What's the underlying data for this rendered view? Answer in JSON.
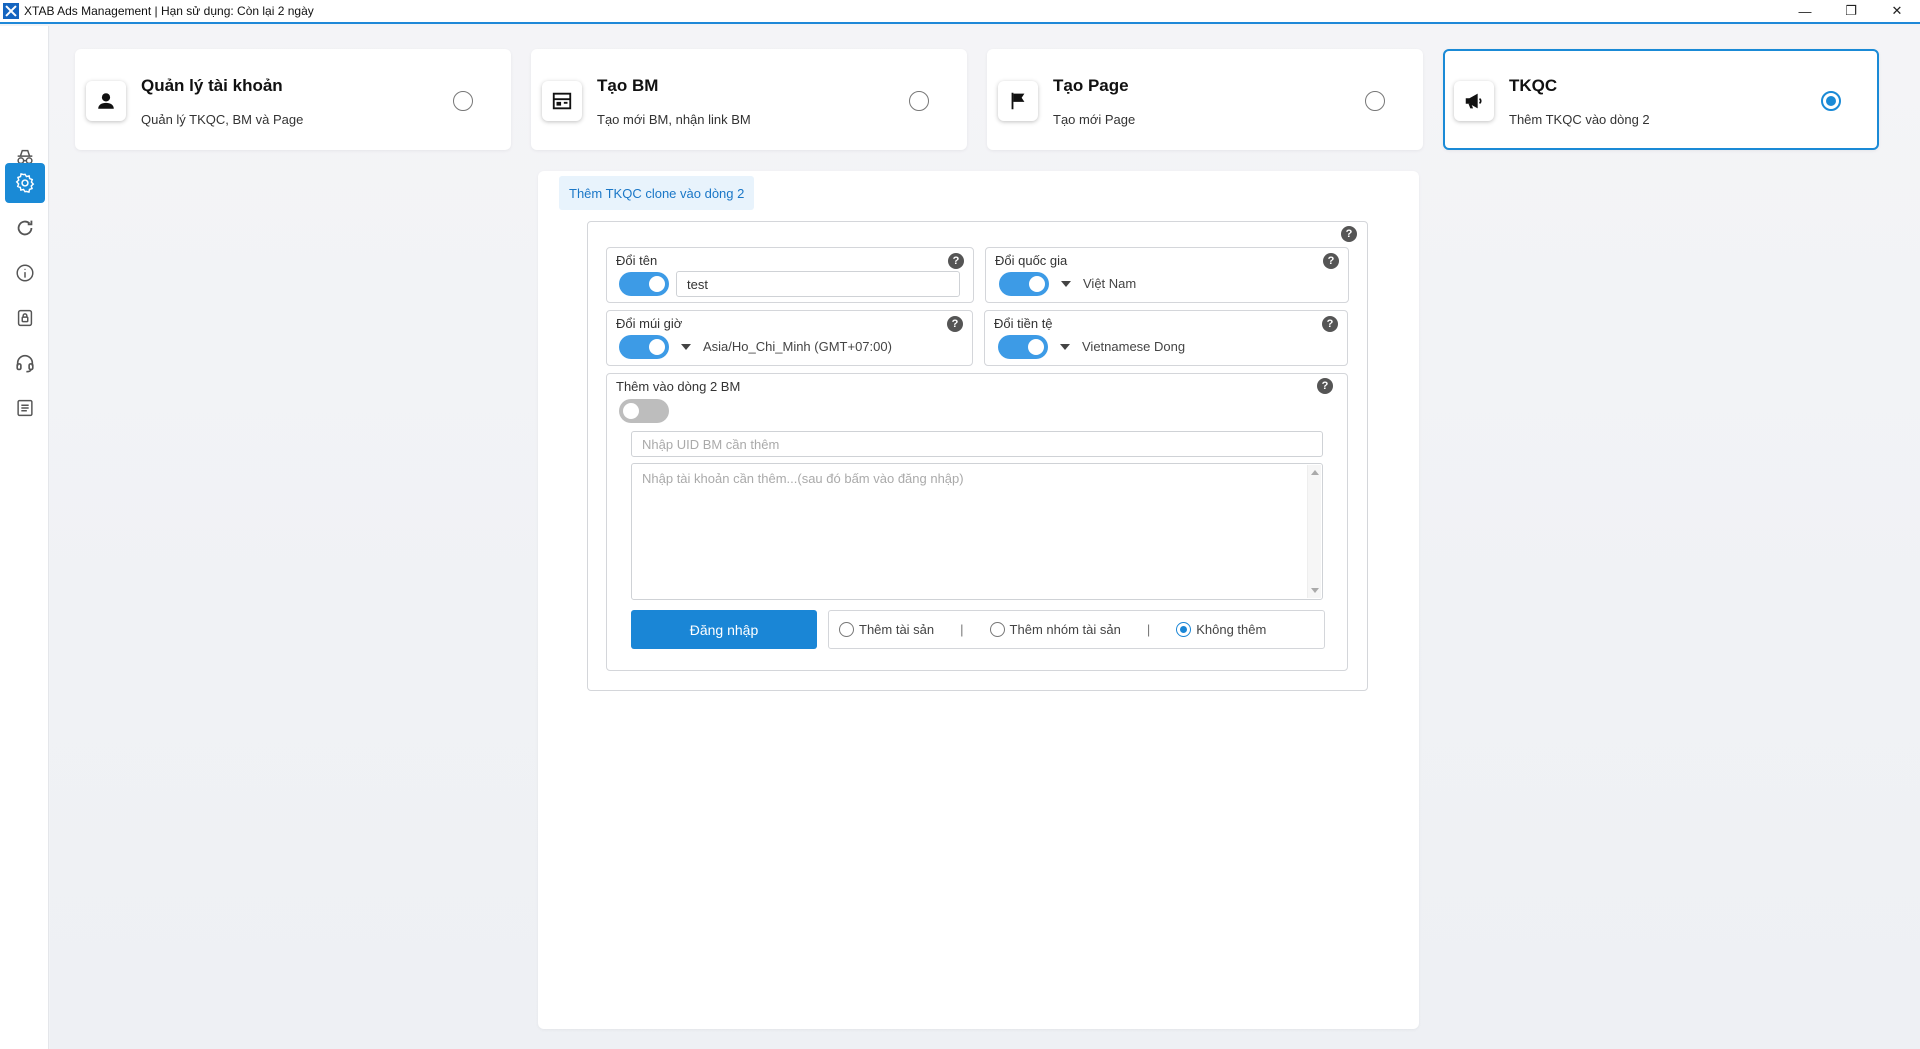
{
  "window": {
    "title": "XTAB Ads Management | Hạn sử dụng: Còn lại 2 ngày",
    "minimize": "—",
    "restore": "❐",
    "close": "✕"
  },
  "sidebar": {
    "items": [
      {
        "icon": "incognito-icon",
        "active": false
      },
      {
        "icon": "gear-icon",
        "active": true
      },
      {
        "icon": "refresh-icon",
        "active": false
      },
      {
        "icon": "info-icon",
        "active": false
      },
      {
        "icon": "lock-icon",
        "active": false
      },
      {
        "icon": "headset-icon",
        "active": false
      },
      {
        "icon": "list-icon",
        "active": false
      }
    ]
  },
  "cards": [
    {
      "title": "Quản lý tài khoản",
      "subtitle": "Quản lý TKQC, BM và Page",
      "icon": "user-icon",
      "selected": false
    },
    {
      "title": "Tạo BM",
      "subtitle": "Tạo mới BM, nhận link BM",
      "icon": "business-icon",
      "selected": false
    },
    {
      "title": "Tạo Page",
      "subtitle": "Tạo mới Page",
      "icon": "flag-icon",
      "selected": false
    },
    {
      "title": "TKQC",
      "subtitle": "Thêm TKQC vào dòng 2",
      "icon": "megaphone-icon",
      "selected": true
    }
  ],
  "panel": {
    "tab_label": "Thêm TKQC clone vào dòng 2",
    "help": "?",
    "rename": {
      "label": "Đổi tên",
      "enabled": true,
      "value": "test"
    },
    "country": {
      "label": "Đổi quốc gia",
      "enabled": true,
      "value": "Việt Nam"
    },
    "timezone": {
      "label": "Đổi múi giờ",
      "enabled": true,
      "value": "Asia/Ho_Chi_Minh (GMT+07:00)"
    },
    "currency": {
      "label": "Đổi tiền tệ",
      "enabled": true,
      "value": "Vietnamese Dong"
    },
    "add_bm": {
      "label": "Thêm vào dòng 2 BM",
      "enabled": false,
      "uid_placeholder": "Nhập UID BM cần thêm",
      "accounts_placeholder": "Nhập tài khoản cần thêm...(sau đó bấm vào đăng nhập)"
    },
    "login_button": "Đăng nhập",
    "options": [
      {
        "label": "Thêm tài sản",
        "checked": false
      },
      {
        "label": "Thêm nhóm tài sản",
        "checked": false
      },
      {
        "label": "Không thêm",
        "checked": true
      }
    ],
    "separator": "|"
  }
}
